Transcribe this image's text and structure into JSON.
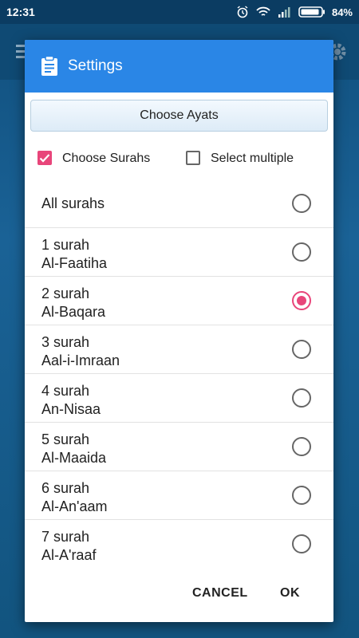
{
  "status_bar": {
    "time": "12:31",
    "battery": "84%"
  },
  "dialog": {
    "title": "Settings",
    "choose_ayats_label": "Choose Ayats",
    "checkboxes": [
      {
        "label": "Choose Surahs",
        "checked": true
      },
      {
        "label": "Select multiple",
        "checked": false
      }
    ],
    "options": [
      {
        "line1": "All surahs",
        "line2": "",
        "selected": false
      },
      {
        "line1": "1 surah",
        "line2": "Al-Faatiha",
        "selected": false
      },
      {
        "line1": "2 surah",
        "line2": "Al-Baqara",
        "selected": true
      },
      {
        "line1": "3 surah",
        "line2": "Aal-i-Imraan",
        "selected": false
      },
      {
        "line1": "4 surah",
        "line2": "An-Nisaa",
        "selected": false
      },
      {
        "line1": "5 surah",
        "line2": "Al-Maaida",
        "selected": false
      },
      {
        "line1": "6 surah",
        "line2": "Al-An'aam",
        "selected": false
      },
      {
        "line1": "7 surah",
        "line2": "Al-A'raaf",
        "selected": false
      }
    ],
    "cancel_label": "CANCEL",
    "ok_label": "OK"
  },
  "colors": {
    "header": "#2a86e6",
    "accent": "#e8457a"
  }
}
